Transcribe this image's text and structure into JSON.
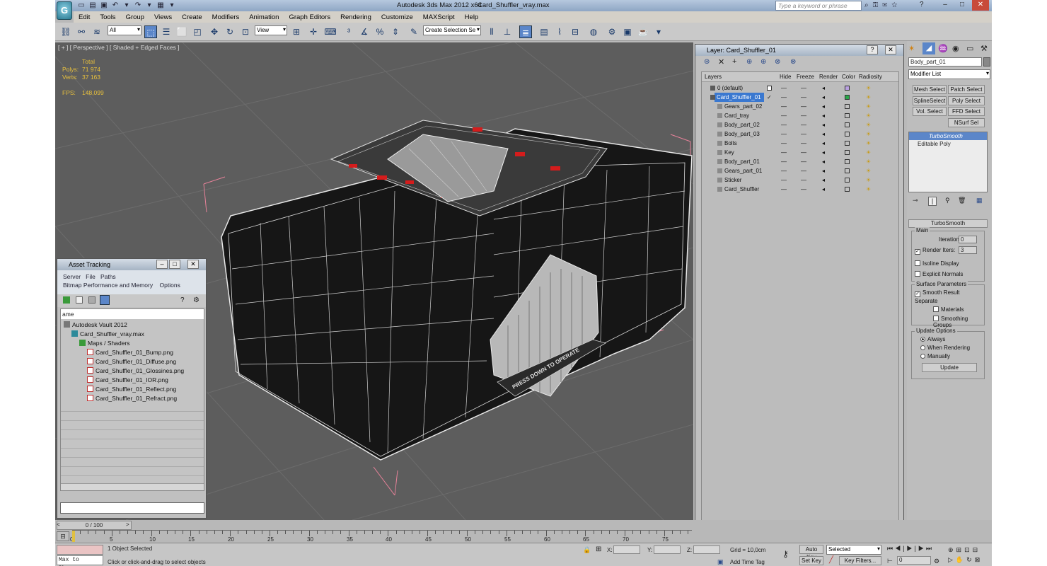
{
  "app": {
    "title": "Autodesk 3ds Max  2012 x64",
    "file": "Card_Shuffler_vray.max",
    "search_placeholder": "Type a keyword or phrase",
    "logo_letter": "G"
  },
  "menu": [
    "Edit",
    "Tools",
    "Group",
    "Views",
    "Create",
    "Modifiers",
    "Animation",
    "Graph Editors",
    "Rendering",
    "Customize",
    "MAXScript",
    "Help"
  ],
  "toolbar": {
    "filter": "All",
    "refcoord": "View",
    "selection_set": "Create Selection Se"
  },
  "viewport": {
    "label": "[ + ] [ Perspective ] [ Shaded + Edged Faces ]",
    "stats_header": "Total",
    "polys_label": "Polys:",
    "polys": "71 974",
    "verts_label": "Verts:",
    "verts": "37 163",
    "fps_label": "FPS:",
    "fps": "148,099",
    "decal": "PRESS DOWN TO OPERATE"
  },
  "asset_tracking": {
    "title": "Asset Tracking",
    "menu1": [
      "Server",
      "File",
      "Paths"
    ],
    "menu2": [
      "Bitmap Performance and Memory",
      "Options"
    ],
    "column": "ame",
    "tree": [
      {
        "label": "Autodesk Vault 2012",
        "indent": 0
      },
      {
        "label": "Card_Shuffler_vray.max",
        "indent": 1
      },
      {
        "label": "Maps / Shaders",
        "indent": 2
      },
      {
        "label": "Card_Shuffler_01_Bump.png",
        "indent": 3
      },
      {
        "label": "Card_Shuffler_01_Diffuse.png",
        "indent": 3
      },
      {
        "label": "Card_Shuffler_01_Glossines.png",
        "indent": 3
      },
      {
        "label": "Card_Shuffler_01_IOR.png",
        "indent": 3
      },
      {
        "label": "Card_Shuffler_01_Reflect.png",
        "indent": 3
      },
      {
        "label": "Card_Shuffler_01_Refract.png",
        "indent": 3
      }
    ]
  },
  "layer_panel": {
    "title": "Layer: Card_Shuffler_01",
    "columns": [
      "Layers",
      "Hide",
      "Freeze",
      "Render",
      "Color",
      "Radiosity"
    ],
    "rows": [
      {
        "name": "0 (default)",
        "indent": 0,
        "color": "#b9a0e0",
        "selected": false
      },
      {
        "name": "Card_Shuffler_01",
        "indent": 0,
        "color": "#2aa84a",
        "selected": true
      },
      {
        "name": "Gears_part_02",
        "indent": 1,
        "color": "#c0c0c0",
        "selected": false
      },
      {
        "name": "Card_tray",
        "indent": 1,
        "color": "#c0c0c0",
        "selected": false
      },
      {
        "name": "Body_part_02",
        "indent": 1,
        "color": "#c0c0c0",
        "selected": false
      },
      {
        "name": "Body_part_03",
        "indent": 1,
        "color": "#c0c0c0",
        "selected": false
      },
      {
        "name": "Bolts",
        "indent": 1,
        "color": "#c0c0c0",
        "selected": false
      },
      {
        "name": "Key",
        "indent": 1,
        "color": "#c0c0c0",
        "selected": false
      },
      {
        "name": "Body_part_01",
        "indent": 1,
        "color": "#c0c0c0",
        "selected": false
      },
      {
        "name": "Gears_part_01",
        "indent": 1,
        "color": "#c0c0c0",
        "selected": false
      },
      {
        "name": "Sticker",
        "indent": 1,
        "color": "#c0c0c0",
        "selected": false
      },
      {
        "name": "Card_Shuffler",
        "indent": 1,
        "color": "#c0c0c0",
        "selected": false
      }
    ]
  },
  "command_panel": {
    "object_name": "Body_part_01",
    "modifier_list": "Modifier List",
    "buttons": [
      "Mesh Select",
      "Patch Select",
      "SplineSelect",
      "Poly Select",
      "Vol. Select",
      "FFD Select",
      "NSurf Sel"
    ],
    "stack": [
      "TurboSmooth",
      "Editable Poly"
    ],
    "rollout": "TurboSmooth",
    "main_group": "Main",
    "iterations_label": "Iterations:",
    "iterations": "0",
    "render_iters_label": "Render Iters:",
    "render_iters": "3",
    "isoline": "Isoline Display",
    "explicit": "Explicit Normals",
    "surface_group": "Surface Parameters",
    "smooth_result": "Smooth Result",
    "separate": "Separate",
    "materials": "Materials",
    "smoothing_groups": "Smoothing Groups",
    "update_group": "Update Options",
    "always": "Always",
    "when_rendering": "When Rendering",
    "manually": "Manually",
    "update_button": "Update"
  },
  "timeline": {
    "range": "0 / 100",
    "ticks": [
      "0",
      "5",
      "10",
      "15",
      "20",
      "25",
      "30",
      "35",
      "40",
      "45",
      "50",
      "55",
      "60",
      "65",
      "70",
      "75"
    ]
  },
  "status": {
    "script_label": "Max to Physc.",
    "selected": "1 Object Selected",
    "prompt": "Click or click-and-drag to select objects",
    "x_label": "X:",
    "y_label": "Y:",
    "z_label": "Z:",
    "grid": "Grid = 10,0cm",
    "add_time_tag": "Add Time Tag",
    "auto_key": "Auto Key",
    "auto_key_mode": "Selected",
    "set_key": "Set Key",
    "key_filters": "Key Filters...",
    "frame": "0"
  }
}
